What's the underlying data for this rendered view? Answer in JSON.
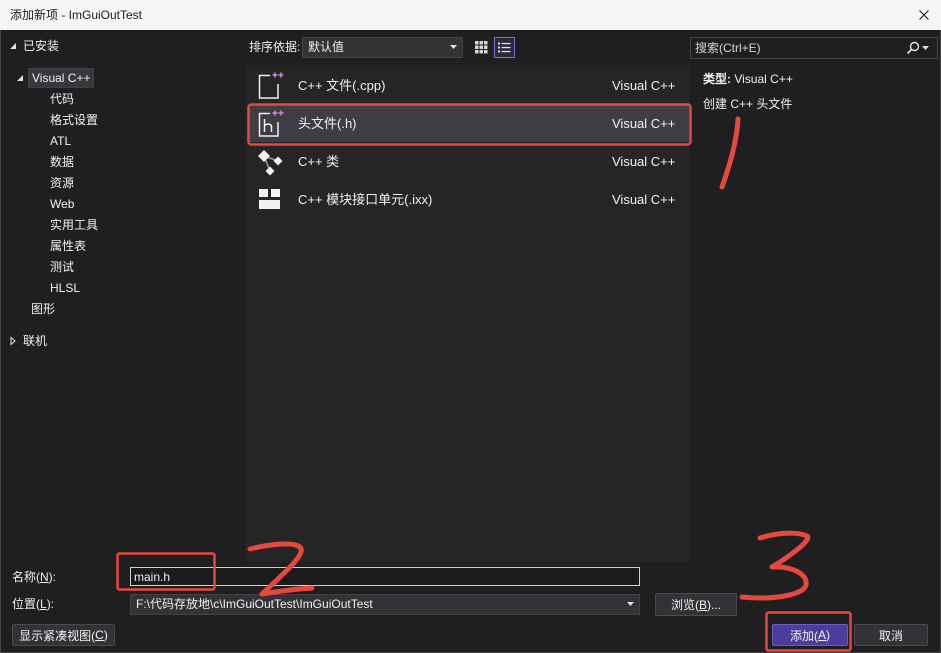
{
  "window": {
    "title": "添加新项 - ImGuiOutTest"
  },
  "tree": {
    "installed": {
      "label": "已安装",
      "expanded": true
    },
    "visual_cpp": {
      "label": "Visual C++",
      "expanded": true,
      "selected": true,
      "children": [
        "代码",
        "格式设置",
        "ATL",
        "数据",
        "资源",
        "Web",
        "实用工具",
        "属性表",
        "测试",
        "HLSL"
      ]
    },
    "graphics": {
      "label": "图形"
    },
    "online": {
      "label": "联机",
      "expanded": false
    }
  },
  "toolbar": {
    "sort_label": "排序依据:",
    "sort_value": "默认值",
    "grid_view_active": false,
    "list_view_active": true
  },
  "search": {
    "placeholder": "搜索(Ctrl+E)"
  },
  "templates": [
    {
      "name": "C++ 文件(.cpp)",
      "language": "Visual C++",
      "icon": "cpp-file-icon",
      "selected": false
    },
    {
      "name": "头文件(.h)",
      "language": "Visual C++",
      "icon": "header-file-icon",
      "selected": true
    },
    {
      "name": "C++ 类",
      "language": "Visual C++",
      "icon": "cpp-class-icon",
      "selected": false
    },
    {
      "name": "C++ 模块接口单元(.ixx)",
      "language": "Visual C++",
      "icon": "module-interface-icon",
      "selected": false
    }
  ],
  "details": {
    "type_label": "类型:",
    "type_value": "Visual C++",
    "description": "创建 C++ 头文件"
  },
  "form": {
    "name_label": "名称(N):",
    "name_value": "main.h",
    "location_label": "位置(L):",
    "location_value": "F:\\代码存放地\\c\\ImGuiOutTest\\ImGuiOutTest",
    "browse_label": "浏览(B)..."
  },
  "buttons": {
    "compact_view": "显示紧凑视图(C)",
    "add": "添加(A)",
    "cancel": "取消"
  },
  "colors": {
    "accent": "#4b3d9b",
    "icon_plus": "#c586e6",
    "annotation": "#e5483f",
    "selection": "#3e3e42"
  }
}
